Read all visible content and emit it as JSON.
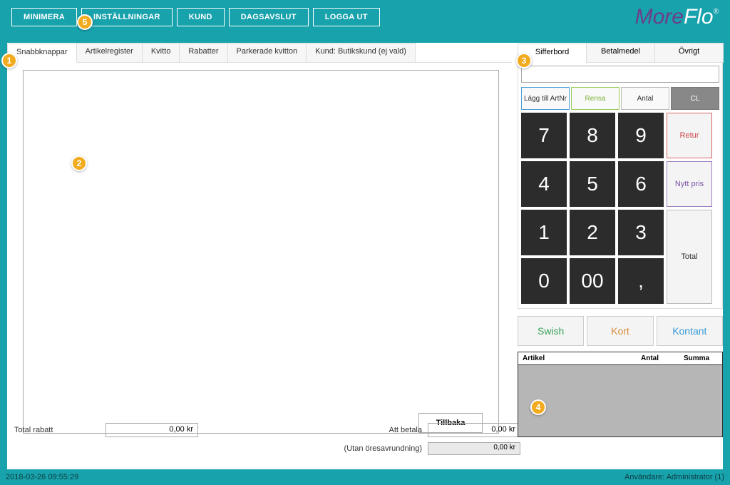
{
  "topbar": {
    "buttons": [
      "MINIMERA",
      "INSTÄLLNINGAR",
      "KUND",
      "DAGSAVSLUT",
      "LOGGA UT"
    ],
    "logo_more": "More",
    "logo_flo": "Flo",
    "logo_reg": "®"
  },
  "left_tabs": [
    "Snabbknappar",
    "Artikelregister",
    "Kvitto",
    "Rabatter",
    "Parkerade kvitton",
    "Kund: Butikskund (ej vald)"
  ],
  "tillbaka": "Tillbaka",
  "totals": {
    "total_rabatt_label": "Total rabatt",
    "total_rabatt_value": "0,00 kr",
    "att_betala_label": "Att betala",
    "att_betala_value": "0,00 kr",
    "oresavrundning_label": "(Utan öresavrundning)",
    "oresavrundning_value": "0,00 kr"
  },
  "right_tabs": [
    "Sifferbord",
    "Betalmedel",
    "Övrigt"
  ],
  "func": {
    "lagg": "Lägg till ArtNr",
    "rensa": "Rensa",
    "antal": "Antal",
    "cl": "CL"
  },
  "numpad": {
    "k7": "7",
    "k8": "8",
    "k9": "9",
    "k4": "4",
    "k5": "5",
    "k6": "6",
    "k1": "1",
    "k2": "2",
    "k3": "3",
    "k0": "0",
    "k00": "00",
    "kc": ","
  },
  "side": {
    "retur": "Retur",
    "nytt": "Nytt pris",
    "total": "Total"
  },
  "pay": {
    "swish": "Swish",
    "kort": "Kort",
    "kontant": "Kontant"
  },
  "items": {
    "artikel": "Artikel",
    "antal": "Antal",
    "summa": "Summa"
  },
  "statusbar": {
    "left": "2018-03-26 09:55:29",
    "right": "Användare: Administrator  (1)"
  },
  "callouts": {
    "c1": "1",
    "c2": "2",
    "c3": "3",
    "c4": "4",
    "c5": "5"
  }
}
